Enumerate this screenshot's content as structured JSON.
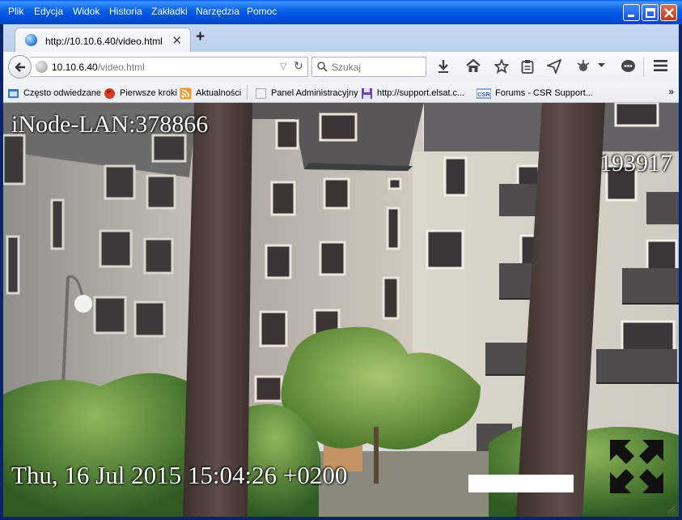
{
  "menu": {
    "items": [
      "Plik",
      "Edycja",
      "Widok",
      "Historia",
      "Zakładki",
      "Narzędzia",
      "Pomoc"
    ]
  },
  "tab": {
    "title": "http://10.10.6.40/video.html",
    "new_tab_label": "+"
  },
  "navbar": {
    "url_host": "10.10.6.40",
    "url_path": "/video.html",
    "search_placeholder": "Szukaj"
  },
  "bookmarks": [
    {
      "label": "Często odwiedzane",
      "icon": "folder-icon"
    },
    {
      "label": "Pierwsze kroki",
      "icon": "firefox-icon"
    },
    {
      "label": "Aktualności",
      "icon": "rss-icon"
    },
    {
      "label": "Panel Administracyjny",
      "icon": "page-icon"
    },
    {
      "label": "http://support.elsat.c...",
      "icon": "floppy-icon"
    },
    {
      "label": "Forums - CSR Support...",
      "icon": "csr-icon"
    }
  ],
  "video": {
    "device_label": "iNode-LAN:378866",
    "counter": "193917",
    "timestamp": "Thu, 16 Jul 2015 15:04:26 +0200"
  },
  "colors": {
    "titlebar_blue": "#0055e5",
    "close_red": "#c0391b"
  }
}
